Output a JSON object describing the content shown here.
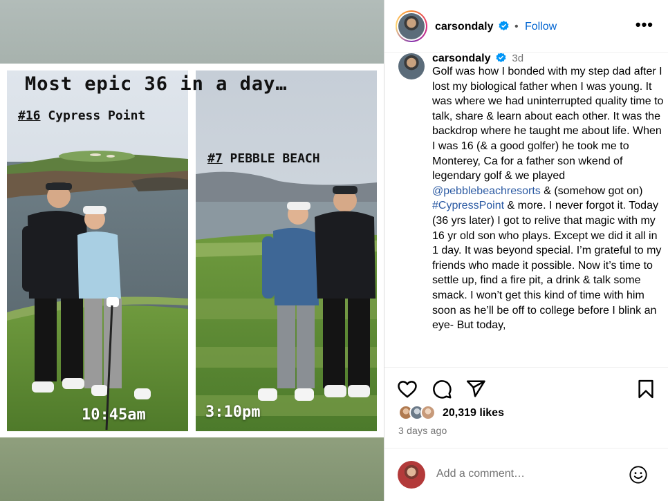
{
  "post": {
    "username": "carsondaly",
    "follow_label": "Follow",
    "separator": "•",
    "more_label": "•••"
  },
  "story": {
    "title": "Most epic 36 in a day…",
    "left": {
      "hole_number": "#16",
      "course_name": "Cypress Point",
      "time": "10:45am"
    },
    "right": {
      "hole_number": "#7",
      "course_name": "PEBBLE BEACH",
      "time": "3:10pm"
    }
  },
  "caption": {
    "username": "carsondaly",
    "age": "3d",
    "text_1": "Golf was how I bonded with my step dad after I lost my biological father when I was young. It was where we had uninterrupted quality time to talk, share & learn about each other. It was the backdrop where he taught me about life. When I was 16 (& a good golfer) he took me to Monterey, Ca for a father son wkend of legendary golf & we played ",
    "mention": "@pebblebeachresorts",
    "text_2": " & (somehow got on) ",
    "hashtag": "#CypressPoint",
    "text_3": " & more. I never forgot it. Today (36 yrs later) I got to relive that magic with my 16 yr old son who plays. Except we did it all in 1 day. It was beyond special. I’m grateful to my friends who made it possible. Now it’s time to settle up, find a fire pit, a drink & talk some smack. I won’t get this kind of time with him soon as he’ll be off to college before I blink an eye- But today,"
  },
  "engagement": {
    "likes": "20,319 likes",
    "time_ago": "3 days ago"
  },
  "comment": {
    "placeholder": "Add a comment…"
  },
  "icons": {
    "verified": "verified-badge-icon",
    "like": "heart-icon",
    "comment": "comment-bubble-icon",
    "share": "paper-plane-icon",
    "save": "bookmark-icon",
    "emoji": "smiley-icon"
  },
  "colors": {
    "link": "#0064d1",
    "mention": "#2b5aa3",
    "verified": "#0095f6",
    "muted": "#737373"
  }
}
